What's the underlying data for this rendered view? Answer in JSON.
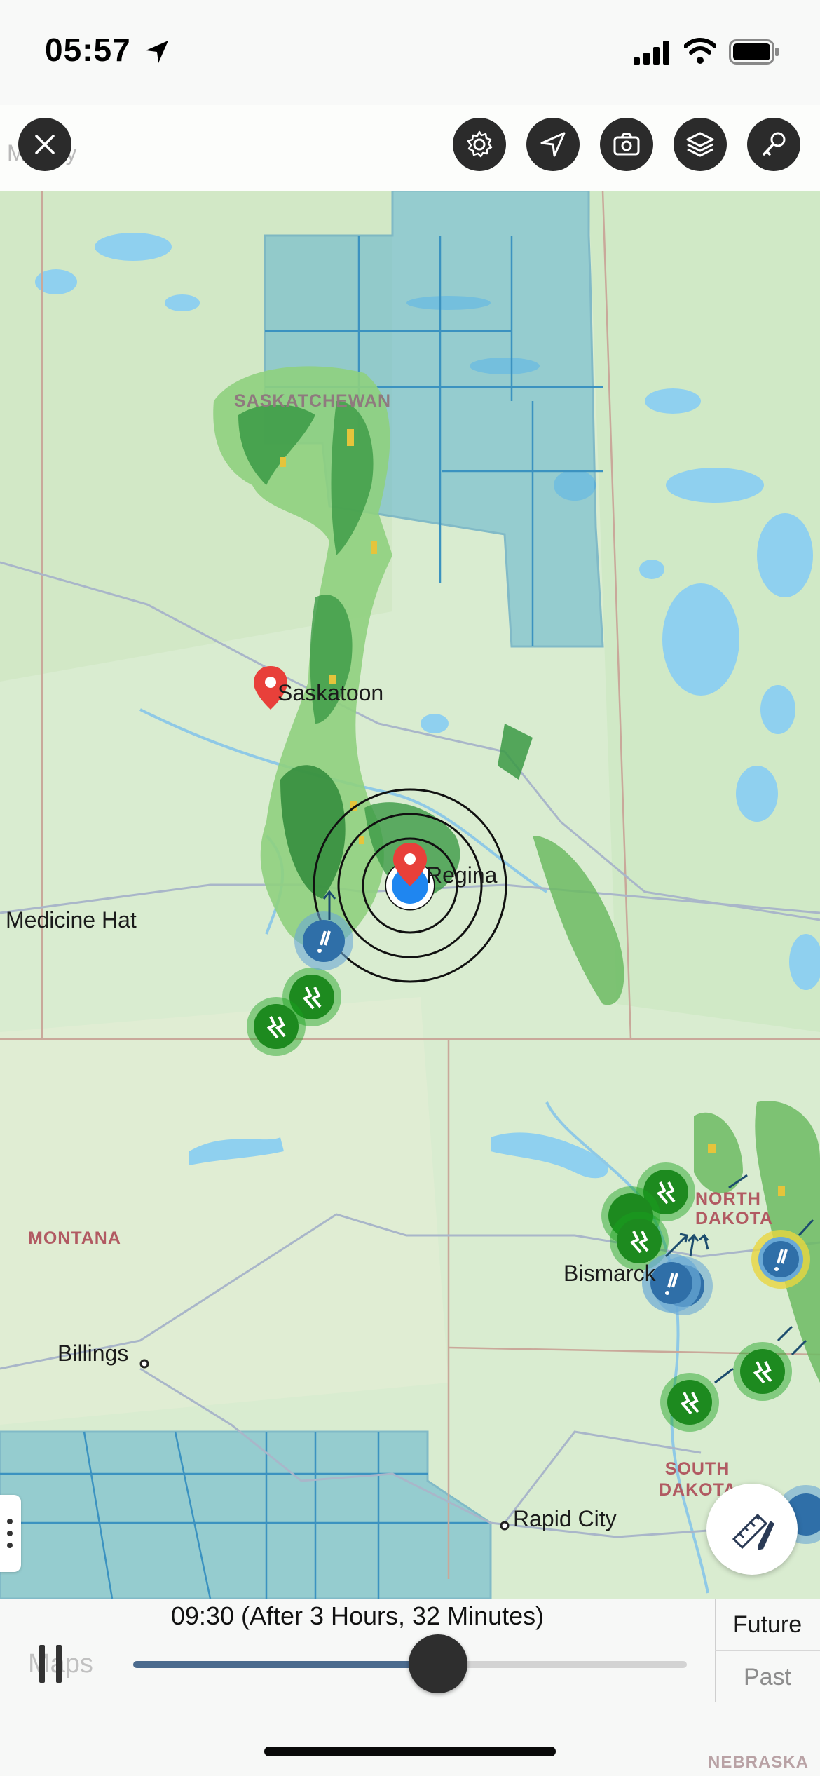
{
  "status_bar": {
    "time": "05:57",
    "icons": [
      "location-arrow-icon",
      "signal-bars-icon",
      "wifi-icon",
      "battery-icon"
    ]
  },
  "toolbar": {
    "faded_label": "Murray",
    "buttons": [
      "close-icon",
      "gear-icon",
      "navigation-arrow-icon",
      "camera-icon",
      "layers-icon",
      "key-icon"
    ]
  },
  "map": {
    "place_labels": {
      "saskatoon": "Saskatoon",
      "regina": "Regina",
      "medicine_hat": "Medicine Hat",
      "bismarck": "Bismarck",
      "billings": "Billings",
      "rapid_city": "Rapid City"
    },
    "region_labels": {
      "saskatchewan": "SASKATCHEWAN",
      "montana": "MONTANA",
      "north_dakota": "NORTH DAKOTA",
      "south_dakota": "SOUTH DAKOTA",
      "nebraska": "NEBRASKA"
    }
  },
  "timeline": {
    "caption": "09:30 (After 3 Hours, 32 Minutes)",
    "progress": 0.55,
    "future_label": "Future",
    "past_label": "Past"
  },
  "watermark": "Maps",
  "colors": {
    "land": "#d9ecd0",
    "water": "#8fd0ef",
    "warning_area": "#5fb2cf",
    "radar_light": "#8fd07e",
    "radar_dark": "#2f8a3a",
    "lightning_marker": "#18a11d",
    "alert_marker": "#2f6fa8",
    "pin": "#e8403a",
    "location_dot": "#1f86f0"
  }
}
